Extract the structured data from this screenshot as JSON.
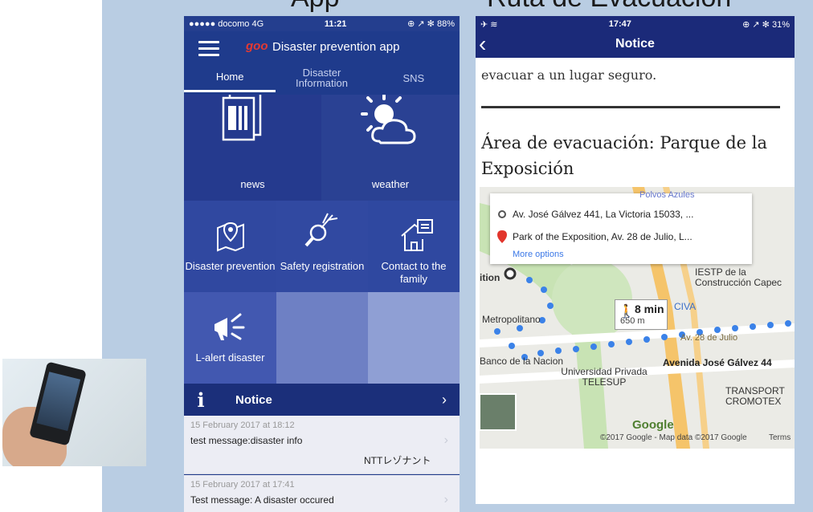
{
  "headings": {
    "left": "App",
    "right": "Ruta de Evacuación"
  },
  "phone1": {
    "status": {
      "carrier": "●●●●● docomo  4G",
      "time": "11:21",
      "battery": "⊕ ↗ ✻ 88%"
    },
    "app_logo": "goo",
    "app_title": "Disaster prevention app",
    "tabs": [
      "Home",
      "Disaster Information",
      "SNS"
    ],
    "tiles": {
      "news": "news",
      "weather": "weather",
      "disaster_prevention": "Disaster prevention",
      "safety_registration": "Safety registration",
      "contact_family": "Contact to the family",
      "lalert": "L-alert disaster"
    },
    "notice": {
      "icon": "i",
      "label": "Notice",
      "chevron": "›"
    },
    "messages": [
      {
        "date": "15 February 2017 at 18:12",
        "text": "test message:disaster info",
        "sender": "NTTレゾナント"
      },
      {
        "date": "15 February 2017 at 17:41",
        "text": "Test message: A disaster occured"
      }
    ]
  },
  "phone2": {
    "status": {
      "time": "17:47",
      "battery": "⊕ ↗ ✻ 31%"
    },
    "title": "Notice",
    "back": "‹",
    "intro_line": "evacuar a un lugar seguro.",
    "section_title": "Área de evacuación: Parque de la Exposición",
    "map": {
      "from": "Av. José Gálvez 441, La Victoria 15033, ...",
      "to": "Park of the Exposition, Av. 28 de Julio, L...",
      "more_options": "More options",
      "walk_time": "8 min",
      "walk_distance": "650 m",
      "labels": {
        "iestp": "IESTP de la Construcción Capec",
        "civa": "CIVA",
        "metropolitano": "Metropolitano",
        "banco": "Banco de la Nacion",
        "universidad": "Universidad Privada TELESUP",
        "avenida": "Avenida José Gálvez 44",
        "transport": "TRANSPORT CROMOTEX",
        "av28": "Av. 28 de Julio",
        "exposition": "ition",
        "polvos": "Polvos Azules",
        "google": "Google",
        "copyright": "©2017 Google - Map data ©2017 Google",
        "terms": "Terms"
      }
    }
  }
}
